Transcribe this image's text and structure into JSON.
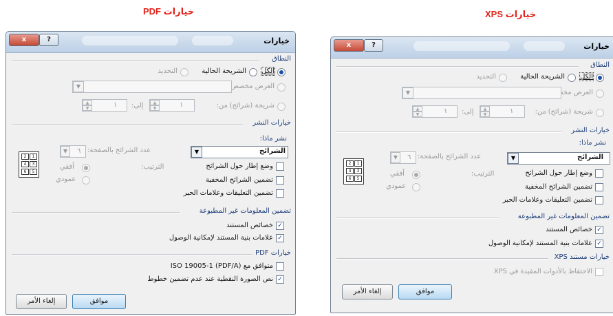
{
  "captions": {
    "pdf": "خيارات PDF",
    "xps": "خيارات XPS"
  },
  "dialog": {
    "title": "خيارات",
    "close": "x",
    "help": "?",
    "range": {
      "heading": "النطاق",
      "all": "الكل",
      "current": "الشريحة الحالية",
      "selection": "التحديد",
      "custom_show": "العرض مخصص:",
      "slides": "شريحة (شرائح)",
      "from": "من:",
      "to": "إلى:",
      "from_value": "١",
      "to_value": "١"
    },
    "publish": {
      "heading": "خيارات النشر",
      "what": "نشر ماذا:",
      "what_value": "الشرائح",
      "per_page": "عدد الشرائح بالصفحة:",
      "per_page_value": "٦",
      "order": "الترتيب:",
      "horizontal": "أفقي",
      "vertical": "عمودي",
      "frame": "وضع إطار حول الشرائح",
      "hidden": "تضمين الشرائح المخفية",
      "comments": "تضمين التعليقات وعلامات الحبر",
      "pages": [
        "2",
        "1",
        "4",
        "3",
        "6",
        "5"
      ]
    },
    "nonprint": {
      "heading": "تضمين المعلومات غير المطبوعة",
      "props": "خصائص المستند",
      "tags": "علامات بنية المستند لإمكانية الوصول"
    },
    "pdf_opts": {
      "heading": "خيارات PDF",
      "iso": "متوافق مع ISO 19005-1 (PDF/A)",
      "bitmap": "نص الصورة النقطية عند عدم تضمين خطوط"
    },
    "xps_opts": {
      "heading": "خيارات مستند XPS",
      "preserve": "الاحتفاظ بالأدوات المقيدة في XPS"
    },
    "ok": "موافق",
    "cancel": "إلغاء الأمر",
    "check_mark": "✓"
  }
}
